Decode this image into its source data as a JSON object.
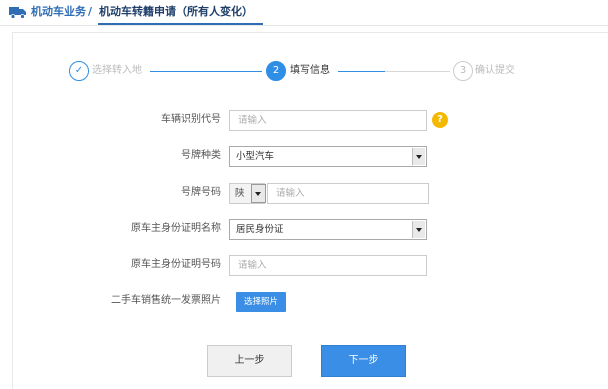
{
  "breadcrumb": {
    "section": "机动车业务",
    "separator": "/",
    "page": "机动车转籍申请（所有人变化）",
    "icon": "truck-icon"
  },
  "steps": [
    {
      "number": "✓",
      "label": "选择转入地",
      "status": "done"
    },
    {
      "number": "2",
      "label": "填写信息",
      "status": "active"
    },
    {
      "number": "3",
      "label": "确认提交",
      "status": "pending"
    }
  ],
  "form": {
    "vin_label": "车辆识别代号",
    "vin_placeholder": "请输入",
    "help_badge": "?",
    "plate_type_label": "号牌种类",
    "plate_type_value": "小型汽车",
    "plate_number_label": "号牌号码",
    "plate_prefix_value": "陕",
    "plate_number_placeholder": "请输入",
    "owner_id_type_label": "原车主身份证明名称",
    "owner_id_type_value": "居民身份证",
    "owner_id_number_label": "原车主身份证明号码",
    "owner_id_number_placeholder": "请输入",
    "invoice_label": "二手车销售统一发票照片",
    "upload_button": "选择照片"
  },
  "actions": {
    "prev": "上一步",
    "next": "下一步"
  },
  "colors": {
    "accent": "#3a8ee6",
    "help": "#f5b800",
    "breadcrumb": "#2f6db5"
  }
}
